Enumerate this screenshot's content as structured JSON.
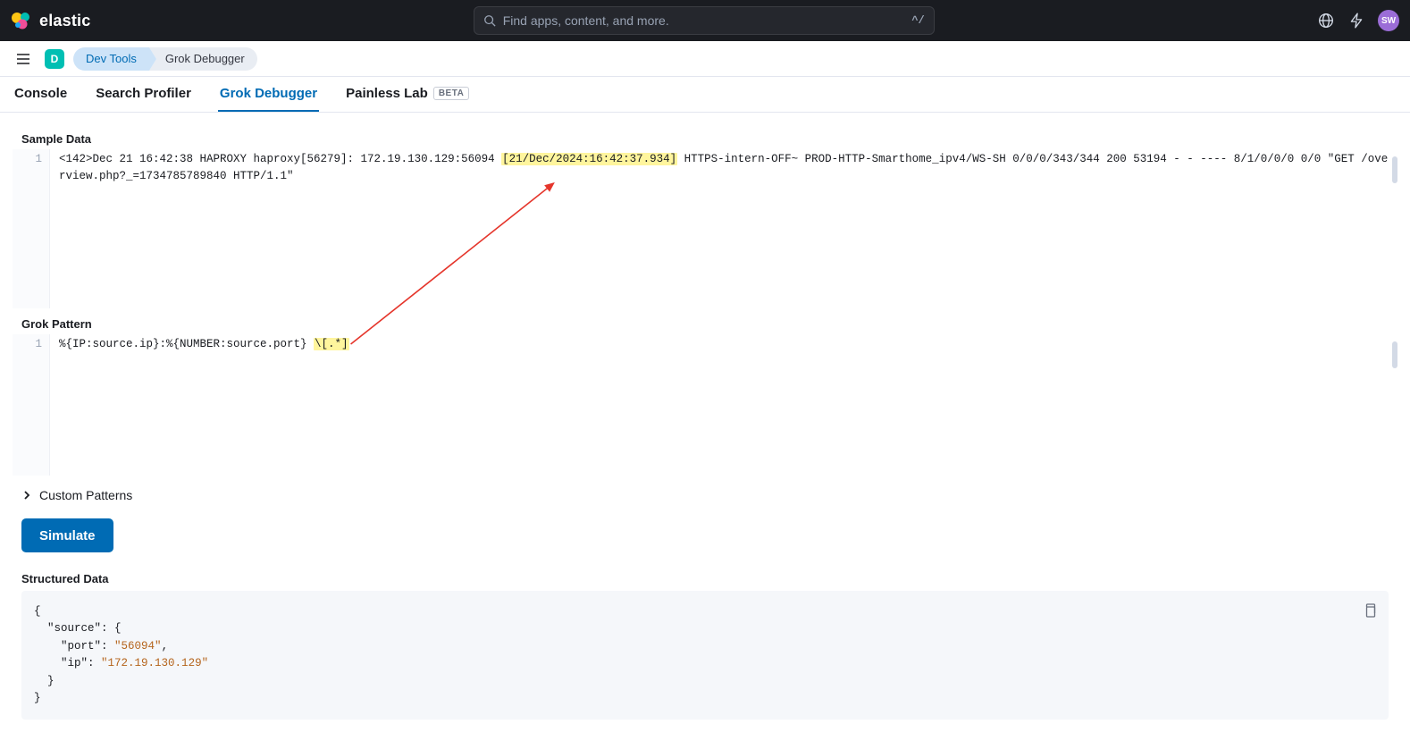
{
  "header": {
    "brand": "elastic",
    "search_placeholder": "Find apps, content, and more.",
    "kbd_hint": "^/",
    "avatar": "SW"
  },
  "breadcrumb": {
    "space": "D",
    "items": [
      "Dev Tools",
      "Grok Debugger"
    ]
  },
  "tabs": {
    "console": "Console",
    "profiler": "Search Profiler",
    "grok": "Grok Debugger",
    "painless": "Painless Lab",
    "beta": "BETA"
  },
  "labels": {
    "sample": "Sample Data",
    "grok": "Grok Pattern",
    "custom": "Custom Patterns",
    "simulate": "Simulate",
    "structured": "Structured Data"
  },
  "sample": {
    "line_no": "1",
    "pre": "<142>Dec 21 16:42:38 HAPROXY haproxy[56279]: 172.19.130.129:56094 ",
    "hl": "[21/Dec/2024:16:42:37.934]",
    "post": " HTTPS-intern-OFF~ PROD-HTTP-Smarthome_ipv4/WS-SH 0/0/0/343/344 200 53194 - - ---- 8/1/0/0/0 0/0 \"GET /overview.php?_=1734785789840 HTTP/1.1\""
  },
  "pattern": {
    "line_no": "1",
    "pre": "%{IP:source.ip}:%{NUMBER:source.port} ",
    "hl": "\\[.*]"
  },
  "output": {
    "source_key": "\"source\"",
    "port_key": "\"port\"",
    "port_val": "\"56094\"",
    "ip_key": "\"ip\"",
    "ip_val": "\"172.19.130.129\""
  }
}
